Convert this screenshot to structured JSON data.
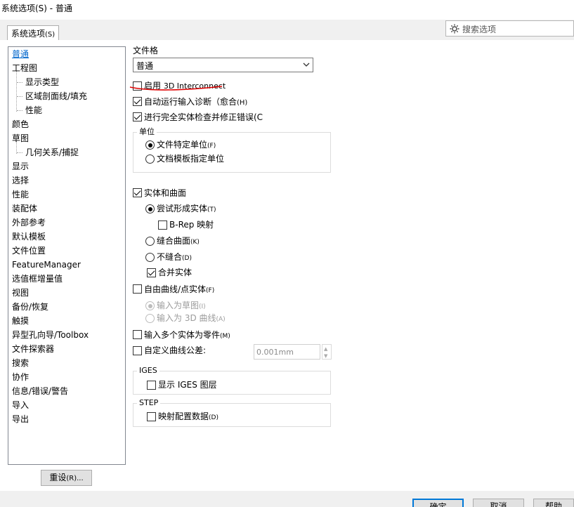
{
  "window": {
    "title": "系统选项(S) - 普通"
  },
  "tab": {
    "label": "系统选项",
    "accel": "(S)"
  },
  "search": {
    "placeholder": "搜索选项",
    "icon": "gear-search-icon"
  },
  "tree": {
    "items": [
      {
        "label": "普通",
        "selected": true
      },
      {
        "label": "工程图"
      },
      {
        "label": "显示类型"
      },
      {
        "label": "区域剖面线/填充"
      },
      {
        "label": "性能"
      },
      {
        "label": "颜色"
      },
      {
        "label": "草图"
      },
      {
        "label": "几何关系/捕捉"
      },
      {
        "label": "显示"
      },
      {
        "label": "选择"
      },
      {
        "label": "性能"
      },
      {
        "label": "装配体"
      },
      {
        "label": "外部参考"
      },
      {
        "label": "默认模板"
      },
      {
        "label": "文件位置"
      },
      {
        "label": "FeatureManager"
      },
      {
        "label": "选值框增量值"
      },
      {
        "label": "视图"
      },
      {
        "label": "备份/恢复"
      },
      {
        "label": "触摸"
      },
      {
        "label": "异型孔向导/Toolbox"
      },
      {
        "label": "文件探索器"
      },
      {
        "label": "搜索"
      },
      {
        "label": "协作"
      },
      {
        "label": "信息/错误/警告"
      },
      {
        "label": "导入"
      },
      {
        "label": "导出"
      }
    ]
  },
  "reset_button": {
    "label": "重设",
    "accel": "(R)..."
  },
  "file_format": {
    "label": "文件格",
    "value": "普通"
  },
  "options": {
    "enable_3d_interconnect": {
      "prefix": "启用 ",
      "label": "3D Interconnect",
      "checked": false
    },
    "auto_diagnose": {
      "label": "自动运行输入诊断（愈合",
      "accel": "(H)",
      "checked": true
    },
    "full_check": {
      "label": "进行完全实体检查并修正错误(C",
      "checked": true
    }
  },
  "units_group": {
    "title": "单位",
    "file_units": {
      "label": "文件特定单位",
      "accel": "(F)",
      "checked": true
    },
    "template_units": {
      "label": "文档模板指定单位",
      "checked": false
    }
  },
  "solids": {
    "label": "实体和曲面",
    "checked": true,
    "try_solid": {
      "label": "尝试形成实体",
      "accel": "(T)",
      "checked": true
    },
    "brep": {
      "label": "B-Rep 映射",
      "checked": false
    },
    "knit": {
      "label": "缝合曲面",
      "accel": "(K)",
      "checked": false
    },
    "no_knit": {
      "label": "不缝合",
      "accel": "(D)",
      "checked": false
    },
    "merge": {
      "label": "合并实体",
      "checked": true
    }
  },
  "free_curves": {
    "label": "自由曲线/点实体",
    "accel": "(F)",
    "checked": false,
    "as_sketch": {
      "label": "输入为草图",
      "accel": "(I)"
    },
    "as_3d": {
      "label": "输入为 3D 曲线",
      "accel": "(A)"
    }
  },
  "multi_bodies": {
    "label": "输入多个实体为零件",
    "accel": "(M)",
    "checked": false
  },
  "custom_tolerance": {
    "label": "自定义曲线公差:",
    "checked": false,
    "value": "0.001mm"
  },
  "iges_group": {
    "title": "IGES",
    "show_layers": {
      "label": "显示 IGES 图层",
      "checked": false
    }
  },
  "step_group": {
    "title": "STEP",
    "map_config": {
      "label": "映射配置数据",
      "accel": "(D)",
      "checked": false
    }
  },
  "footer": {
    "ok": "确定",
    "cancel": "取消",
    "help": "帮助"
  },
  "colors": {
    "annotation_red": "#e00000",
    "selected_link": "#0066cc"
  }
}
